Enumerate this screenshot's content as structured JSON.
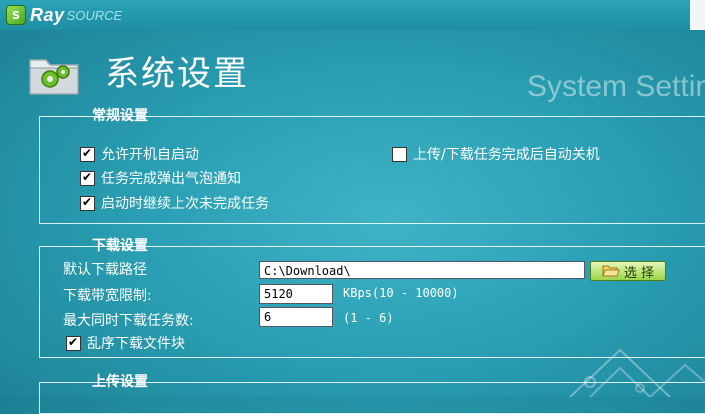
{
  "app": {
    "logo_text1": "Ray",
    "logo_text2": "SOURCE"
  },
  "page": {
    "title": "系统设置",
    "subtitle": "System Settin",
    "icon": "settings-folder-icon"
  },
  "general": {
    "title": "常规设置",
    "items": [
      {
        "label": "允许开机自启动",
        "checked": true
      },
      {
        "label": "任务完成弹出气泡通知",
        "checked": true
      },
      {
        "label": "启动时继续上次未完成任务",
        "checked": true
      },
      {
        "label": "上传/下载任务完成后自动关机",
        "checked": false
      }
    ]
  },
  "download": {
    "title": "下载设置",
    "path_label": "默认下载路径",
    "path_value": "C:\\Download\\",
    "browse_label": "选 择",
    "bandwidth_label": "下载带宽限制:",
    "bandwidth_value": "5120",
    "bandwidth_hint": "KBps(10 - 10000)",
    "max_tasks_label": "最大同时下载任务数:",
    "max_tasks_value": "6",
    "max_tasks_hint": "(1 - 6)",
    "random_block_label": "乱序下载文件块",
    "random_block_checked": true
  },
  "upload": {
    "title": "上传设置"
  },
  "colors": {
    "background": "#2a9fb3",
    "button": "#9cd44a"
  }
}
